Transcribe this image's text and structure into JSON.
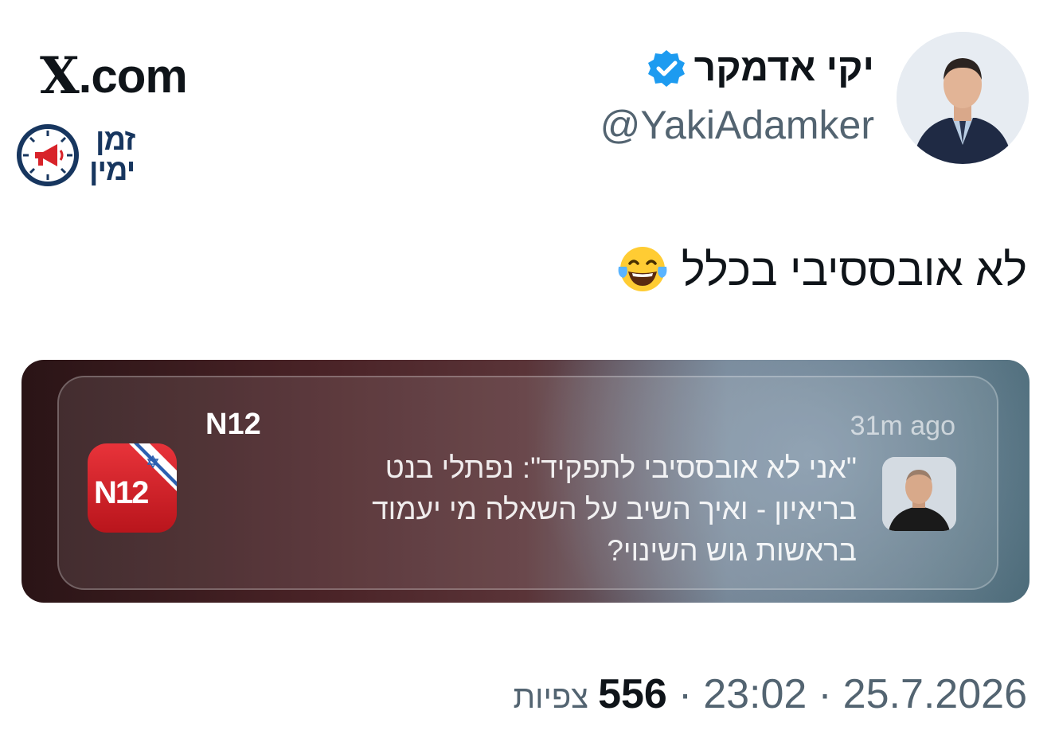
{
  "header": {
    "site_logo": "X",
    "site_name": ".com",
    "brand_lines": [
      "זמן",
      "ימין"
    ],
    "brand_color": "#17365f"
  },
  "author": {
    "display_name": "יקי אדמקר",
    "handle": "@YakiAdamker",
    "verified": true,
    "verified_color": "#1d9bf0",
    "avatar_icon": "avatar-photo"
  },
  "tweet": {
    "text": "לא אובססיבי בכלל",
    "emoji_icon": "face-with-tears-of-joy-icon"
  },
  "notification": {
    "app_name": "N12",
    "app_icon_text": "N12",
    "time_ago": "31m ago",
    "body_lines": [
      "\"אני לא אובססיבי לתפקיד\": נפתלי בנט",
      "בריאיון - ואיך השיב על השאלה מי יעמוד",
      "בראשות גוש השינוי?"
    ]
  },
  "meta": {
    "date": "25.7.2026",
    "time": "23:02",
    "separator": "·",
    "views_count": "556",
    "views_label": "צפיות"
  },
  "colors": {
    "text_primary": "#0f1419",
    "text_secondary": "#536471",
    "n12_red": "#d8232a"
  }
}
